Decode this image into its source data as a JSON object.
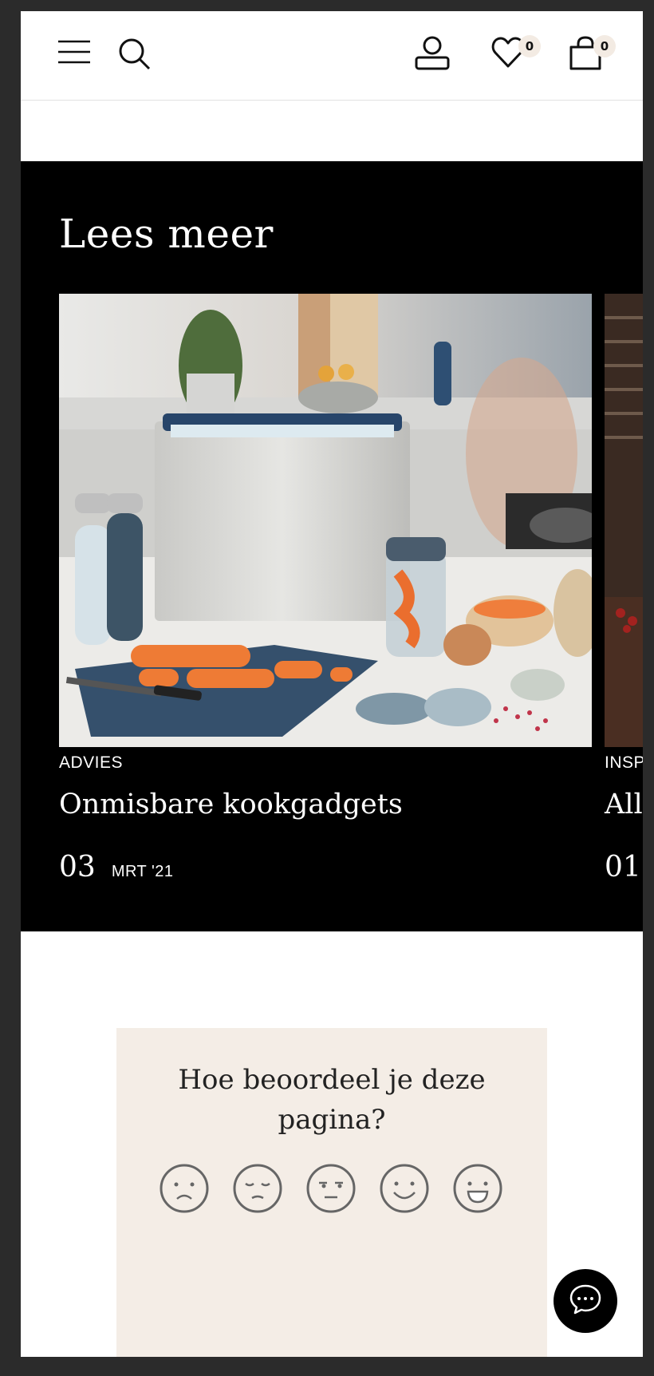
{
  "header": {
    "menu_icon": "hamburger-icon",
    "search_icon": "search-icon",
    "account_icon": "account-icon",
    "wishlist_icon": "heart-icon",
    "wishlist_count": "0",
    "cart_icon": "shopping-bag-icon",
    "cart_count": "0"
  },
  "read_more": {
    "title": "Lees meer",
    "articles": [
      {
        "category": "ADVIES",
        "title": "Onmisbare kookgadgets",
        "day": "03",
        "month": "MRT '21"
      },
      {
        "category": "INSP",
        "title": "All",
        "day": "01",
        "month": ""
      }
    ]
  },
  "rating": {
    "question": "Hoe beoordeel je deze pagina?",
    "faces": [
      "very-unhappy-face-icon",
      "unhappy-face-icon",
      "neutral-face-icon",
      "happy-face-icon",
      "very-happy-face-icon"
    ]
  },
  "chat": {
    "icon": "chat-bubble-icon"
  },
  "colors": {
    "section_bg": "#000000",
    "rating_bg": "#f4ede6",
    "badge_bg": "#f3ebe3",
    "outer_bg": "#2b2b2b"
  }
}
